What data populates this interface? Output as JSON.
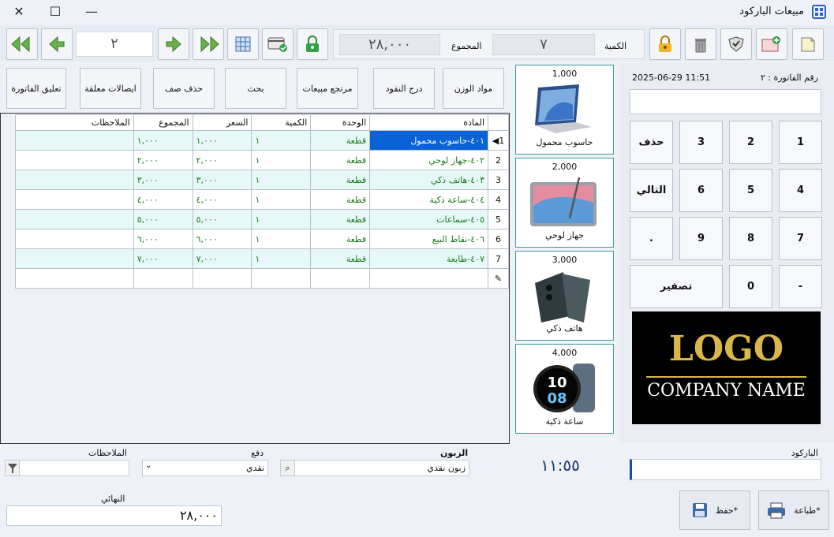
{
  "window": {
    "title": "مبيعات الباركود"
  },
  "toolbar": {
    "page_number": "٢",
    "total_value": "٢٨,٠٠٠",
    "total_label": "المجموع",
    "quantity_value": "٧",
    "quantity_label": "الكمية"
  },
  "actions": [
    "مواد الوزن",
    "درج النقود",
    "مرتجع مبيعات",
    "بحث",
    "حذف صف",
    "ايصالات معلقة",
    "تعليق الفاتورة"
  ],
  "invoice": {
    "label": "رقم الفاتورة : ٢",
    "datetime": "2025-06-29 11:51"
  },
  "keypad": {
    "k1": "1",
    "k2": "2",
    "k3": "3",
    "delete": "حذف",
    "k4": "4",
    "k5": "5",
    "k6": "6",
    "next": "التالي",
    "k7": "7",
    "k8": "8",
    "k9": "9",
    "dot": ".",
    "minus": "-",
    "k0": "0",
    "clear": "تصفير"
  },
  "logo": {
    "line1": "LOGO",
    "line2": "COMPANY NAME"
  },
  "products": [
    {
      "price": "1,000",
      "name": "حاسوب محمول"
    },
    {
      "price": "2,000",
      "name": "جهاز لوحي"
    },
    {
      "price": "3,000",
      "name": "هاتف ذكي"
    },
    {
      "price": "4,000",
      "name": "ساعة ذكية"
    }
  ],
  "table": {
    "headers": {
      "item": "المادة",
      "unit": "الوحدة",
      "qty": "الكمية",
      "price": "السعر",
      "total": "المجموع",
      "notes": "الملاحظات"
    },
    "rows": [
      {
        "num": "1",
        "item": "٤٠١-حاسوب محمول",
        "unit": "قطعة",
        "qty": "١",
        "price": "١,٠٠٠",
        "total": "١,٠٠٠"
      },
      {
        "num": "2",
        "item": "٤٠٢-جهاز لوحي",
        "unit": "قطعة",
        "qty": "١",
        "price": "٢,٠٠٠",
        "total": "٢,٠٠٠"
      },
      {
        "num": "3",
        "item": "٤٠٣-هاتف ذكي",
        "unit": "قطعة",
        "qty": "١",
        "price": "٣,٠٠٠",
        "total": "٣,٠٠٠"
      },
      {
        "num": "4",
        "item": "٤٠٤-ساعة ذكية",
        "unit": "قطعة",
        "qty": "١",
        "price": "٤,٠٠٠",
        "total": "٤,٠٠٠"
      },
      {
        "num": "5",
        "item": "٤٠٥-سماعات",
        "unit": "قطعة",
        "qty": "١",
        "price": "٥,٠٠٠",
        "total": "٥,٠٠٠"
      },
      {
        "num": "6",
        "item": "٤٠٦-نقاط البيع",
        "unit": "قطعة",
        "qty": "١",
        "price": "٦,٠٠٠",
        "total": "٦,٠٠٠"
      },
      {
        "num": "7",
        "item": "٤٠٧-طابعة",
        "unit": "قطعة",
        "qty": "١",
        "price": "٧,٠٠٠",
        "total": "٧,٠٠٠"
      }
    ]
  },
  "footer": {
    "barcode_label": "الباركود",
    "time": "١١:٥٥",
    "customer_label": "الزبون",
    "customer_value": "زبون نقدي",
    "payment_label": "دفع",
    "payment_value": "نقدي",
    "notes_label": "الملاحظات",
    "final_label": "النهائي",
    "final_value": "٢٨,٠٠٠",
    "print_label": "طباعة*",
    "save_label": "حفظ*"
  }
}
